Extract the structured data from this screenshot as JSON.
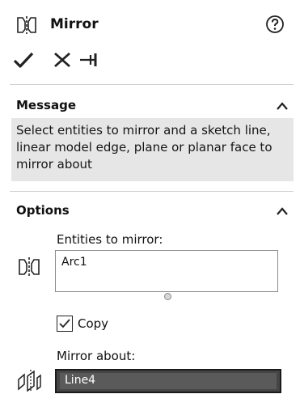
{
  "header": {
    "title": "Mirror",
    "title_icon": "mirror-entities-icon",
    "help_icon": "question-mark-circle-icon"
  },
  "toolbar": {
    "ok_icon": "checkmark-icon",
    "cancel_icon": "close-x-icon",
    "pin_icon": "pushpin-icon"
  },
  "message_section": {
    "title": "Message",
    "text": "Select entities to mirror and a sketch line, linear model edge, plane or planar face to mirror about"
  },
  "options_section": {
    "title": "Options",
    "entities_label": "Entities to mirror:",
    "entities_value": "Arc1",
    "copy_label": "Copy",
    "copy_checked": true,
    "mirror_about_label": "Mirror about:",
    "mirror_about_value": "Line4"
  },
  "colors": {
    "message_background": "#e6e6e6",
    "selected_field_background": "#454545",
    "separator": "#cfcfcf"
  }
}
